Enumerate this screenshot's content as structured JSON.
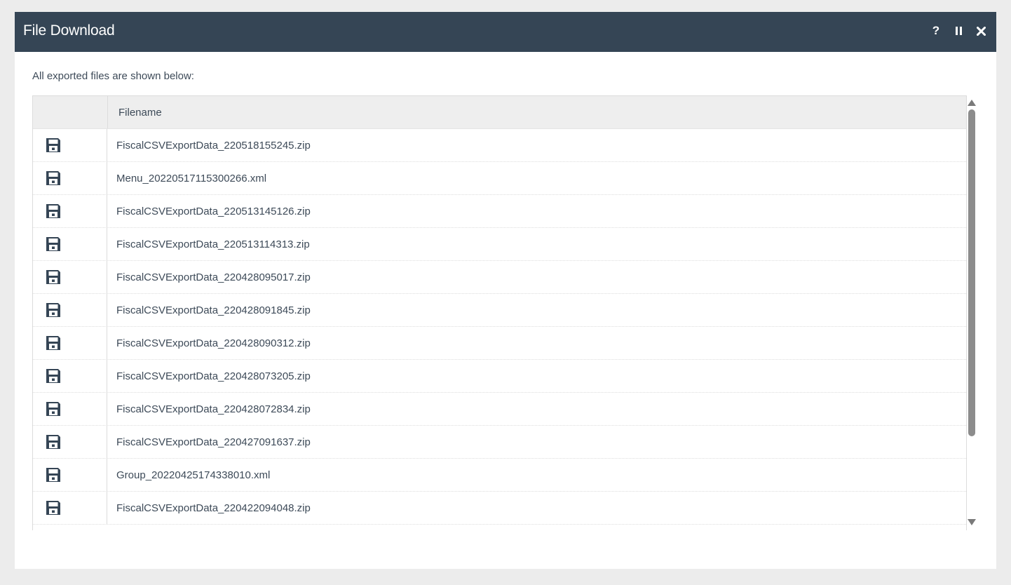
{
  "dialog": {
    "title": "File Download",
    "help_label": "?",
    "intro": "All exported files are shown below:"
  },
  "grid": {
    "columns": [
      "",
      "Filename"
    ],
    "rows": [
      {
        "filename": "FiscalCSVExportData_220518155245.zip"
      },
      {
        "filename": "Menu_20220517115300266.xml"
      },
      {
        "filename": "FiscalCSVExportData_220513145126.zip"
      },
      {
        "filename": "FiscalCSVExportData_220513114313.zip"
      },
      {
        "filename": "FiscalCSVExportData_220428095017.zip"
      },
      {
        "filename": "FiscalCSVExportData_220428091845.zip"
      },
      {
        "filename": "FiscalCSVExportData_220428090312.zip"
      },
      {
        "filename": "FiscalCSVExportData_220428073205.zip"
      },
      {
        "filename": "FiscalCSVExportData_220428072834.zip"
      },
      {
        "filename": "FiscalCSVExportData_220427091637.zip"
      },
      {
        "filename": "Group_20220425174338010.xml"
      },
      {
        "filename": "FiscalCSVExportData_220422094048.zip"
      }
    ]
  },
  "colors": {
    "titlebar": "#354555",
    "icon": "#354555",
    "text": "#3d4a58"
  },
  "icons": {
    "row_icon": "floppy-disk-icon",
    "help": "help-icon",
    "pause": "pause-icon",
    "close": "close-icon"
  }
}
